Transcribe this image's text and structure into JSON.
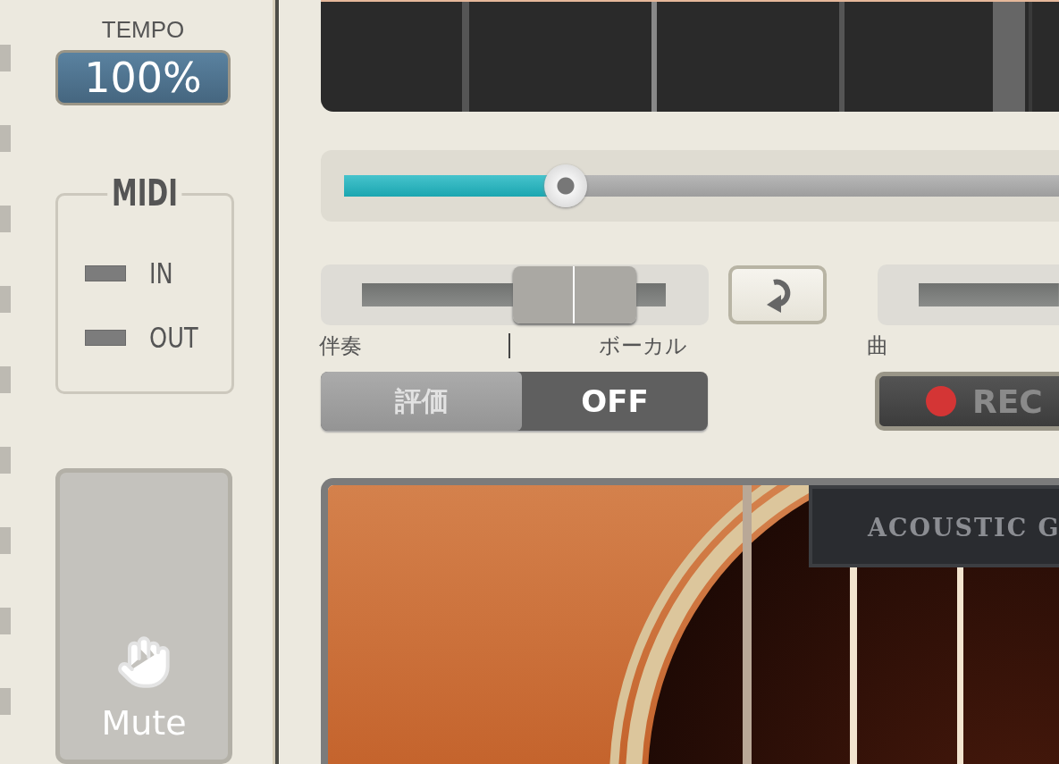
{
  "tempo": {
    "label": "TEMPO",
    "value": "100%"
  },
  "midi": {
    "title": "MIDI",
    "ports": [
      {
        "label": "IN",
        "active": false
      },
      {
        "label": "OUT",
        "active": false
      }
    ]
  },
  "mute_button": {
    "label": "Mute"
  },
  "position_slider": {
    "level": 0.31
  },
  "balance_slider": {
    "level": 0.7,
    "left_label": "伴奏",
    "right_label": "ボーカル"
  },
  "song_slider": {
    "label": "曲"
  },
  "rating_toggle": {
    "label": "評価",
    "state_label": "OFF",
    "on": false
  },
  "rec_button": {
    "label": "REC"
  },
  "guitar": {
    "label": "ACOUSTIC G"
  }
}
